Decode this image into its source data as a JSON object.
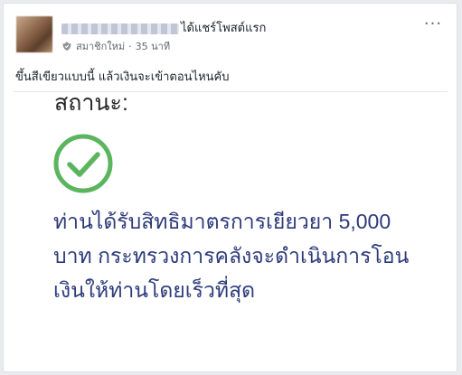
{
  "post": {
    "author_action": "ได้แชร์โพสต์แรก",
    "member_label": "สมาชิกใหม่",
    "separator": "·",
    "time": "35 นาที",
    "more_label": "···",
    "text": "ขึ้นสีเขียวแบบนี้ แล้วเงินจะเข้าตอนไหนคับ"
  },
  "shared_image": {
    "status_label": "สถานะ:",
    "icon": "check-circle-icon",
    "message_lines": [
      "ท่านได้รับสิทธิมาตรการเยียวยา 5,000",
      "บาท กระทรวงการคลังจะดำเนินการโอน",
      "เงินให้ท่านโดยเร็วที่สุด"
    ]
  },
  "colors": {
    "check_green": "#5ab55e",
    "message_blue": "#2c3a7a",
    "background": "#e9ebee"
  }
}
